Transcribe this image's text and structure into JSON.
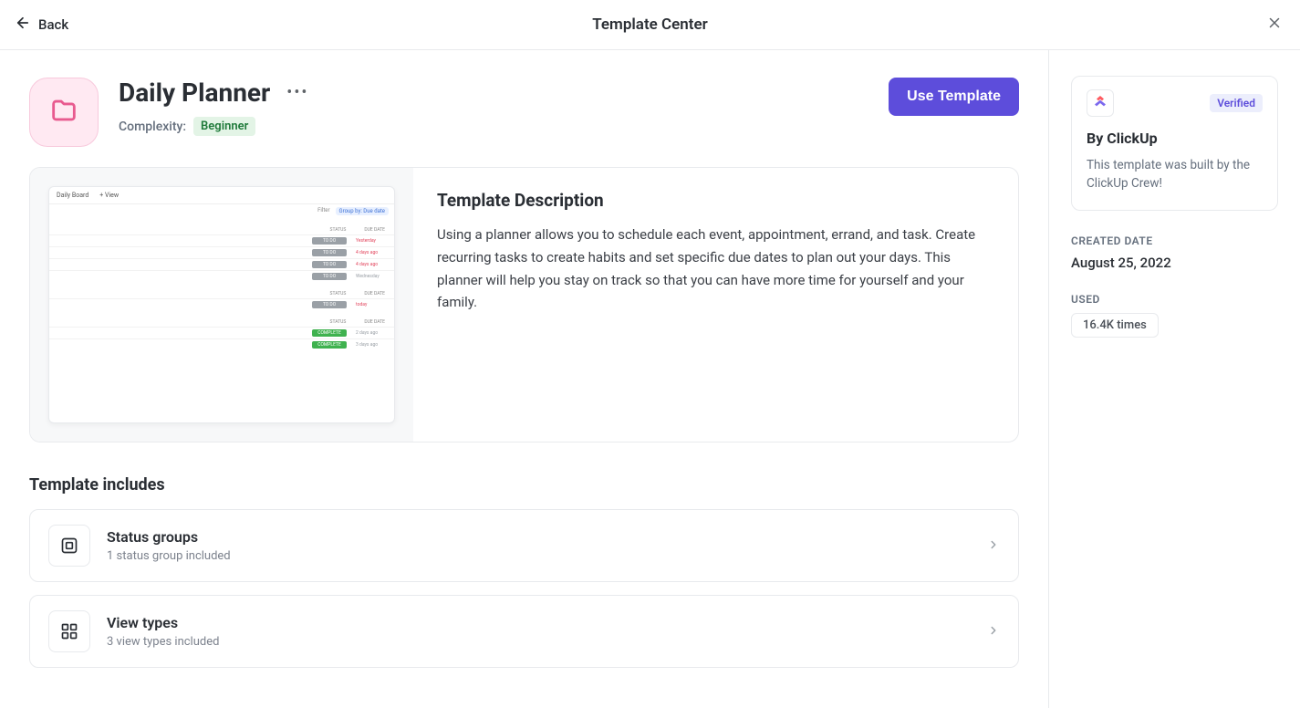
{
  "header": {
    "back_label": "Back",
    "title": "Template Center"
  },
  "template": {
    "title": "Daily Planner",
    "complexity_label": "Complexity:",
    "complexity_value": "Beginner",
    "use_button_label": "Use Template"
  },
  "description": {
    "heading": "Template Description",
    "text": "Using a planner allows you to schedule each event, appointment, errand, and task. Create recurring tasks to create habits and set specific due dates to plan out your days. This planner will help you stay on track so that you can have more time for yourself and your family."
  },
  "preview": {
    "tabs": [
      "Daily Board",
      "+ View"
    ],
    "filter_label": "Filter",
    "group_label": "Group by: Due date",
    "cols": [
      "STATUS",
      "DUE DATE"
    ],
    "groups": [
      {
        "rows": [
          {
            "status": "TO DO",
            "status_kind": "todo",
            "due": "Yesterday",
            "due_kind": "red"
          },
          {
            "status": "TO DO",
            "status_kind": "todo",
            "due": "4 days ago",
            "due_kind": "red"
          },
          {
            "status": "TO DO",
            "status_kind": "todo",
            "due": "4 days ago",
            "due_kind": "red"
          },
          {
            "status": "TO DO",
            "status_kind": "todo",
            "due": "Wednesday",
            "due_kind": "gray"
          }
        ]
      },
      {
        "rows": [
          {
            "status": "TO DO",
            "status_kind": "todo",
            "due": "today",
            "due_kind": "red"
          }
        ]
      },
      {
        "rows": [
          {
            "status": "COMPLETE",
            "status_kind": "complete",
            "due": "2 days ago",
            "due_kind": "gray"
          },
          {
            "status": "COMPLETE",
            "status_kind": "complete",
            "due": "3 days ago",
            "due_kind": "gray"
          }
        ]
      }
    ]
  },
  "includes": {
    "heading": "Template includes",
    "items": [
      {
        "icon": "status-groups-icon",
        "title": "Status groups",
        "subtitle": "1 status group included"
      },
      {
        "icon": "view-types-icon",
        "title": "View types",
        "subtitle": "3 view types included"
      }
    ]
  },
  "author": {
    "verified_label": "Verified",
    "name": "By ClickUp",
    "desc": "This template was built by the ClickUp Crew!"
  },
  "meta": {
    "created_label": "CREATED DATE",
    "created_value": "August 25, 2022",
    "used_label": "USED",
    "used_value": "16.4K times"
  }
}
